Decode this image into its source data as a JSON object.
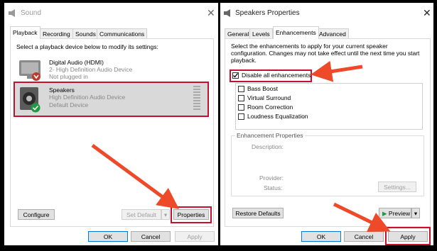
{
  "sound_window": {
    "title": "Sound",
    "tabs": [
      "Playback",
      "Recording",
      "Sounds",
      "Communications"
    ],
    "instruction": "Select a playback device below to modify its settings:",
    "devices": [
      {
        "name": "Digital Audio (HDMI)",
        "line2": "2- High Definition Audio Device",
        "line3": "Not plugged in"
      },
      {
        "name": "Speakers",
        "line2": "High Definition Audio Device",
        "line3": "Default Device"
      }
    ],
    "buttons": {
      "configure": "Configure",
      "set_default": "Set Default",
      "properties": "Properties",
      "ok": "OK",
      "cancel": "Cancel",
      "apply": "Apply"
    }
  },
  "speakers_window": {
    "title": "Speakers Properties",
    "tabs": [
      "General",
      "Levels",
      "Enhancements",
      "Advanced"
    ],
    "instruction": "Select the enhancements to apply for your current speaker configuration. Changes may not take effect until the next time you start playback.",
    "disable_all": "Disable all enhancements",
    "enhancements": [
      "Bass Boost",
      "Virtual Surround",
      "Room Correction",
      "Loudness Equalization"
    ],
    "properties_group": {
      "title": "Enhancement Properties",
      "description_label": "Description:",
      "provider_label": "Provider:",
      "status_label": "Status:",
      "settings_button": "Settings..."
    },
    "buttons": {
      "restore": "Restore Defaults",
      "preview": "Preview",
      "ok": "OK",
      "cancel": "Cancel",
      "apply": "Apply"
    }
  },
  "colors": {
    "highlight": "#c8102e",
    "arrow": "#ee4a2a"
  }
}
